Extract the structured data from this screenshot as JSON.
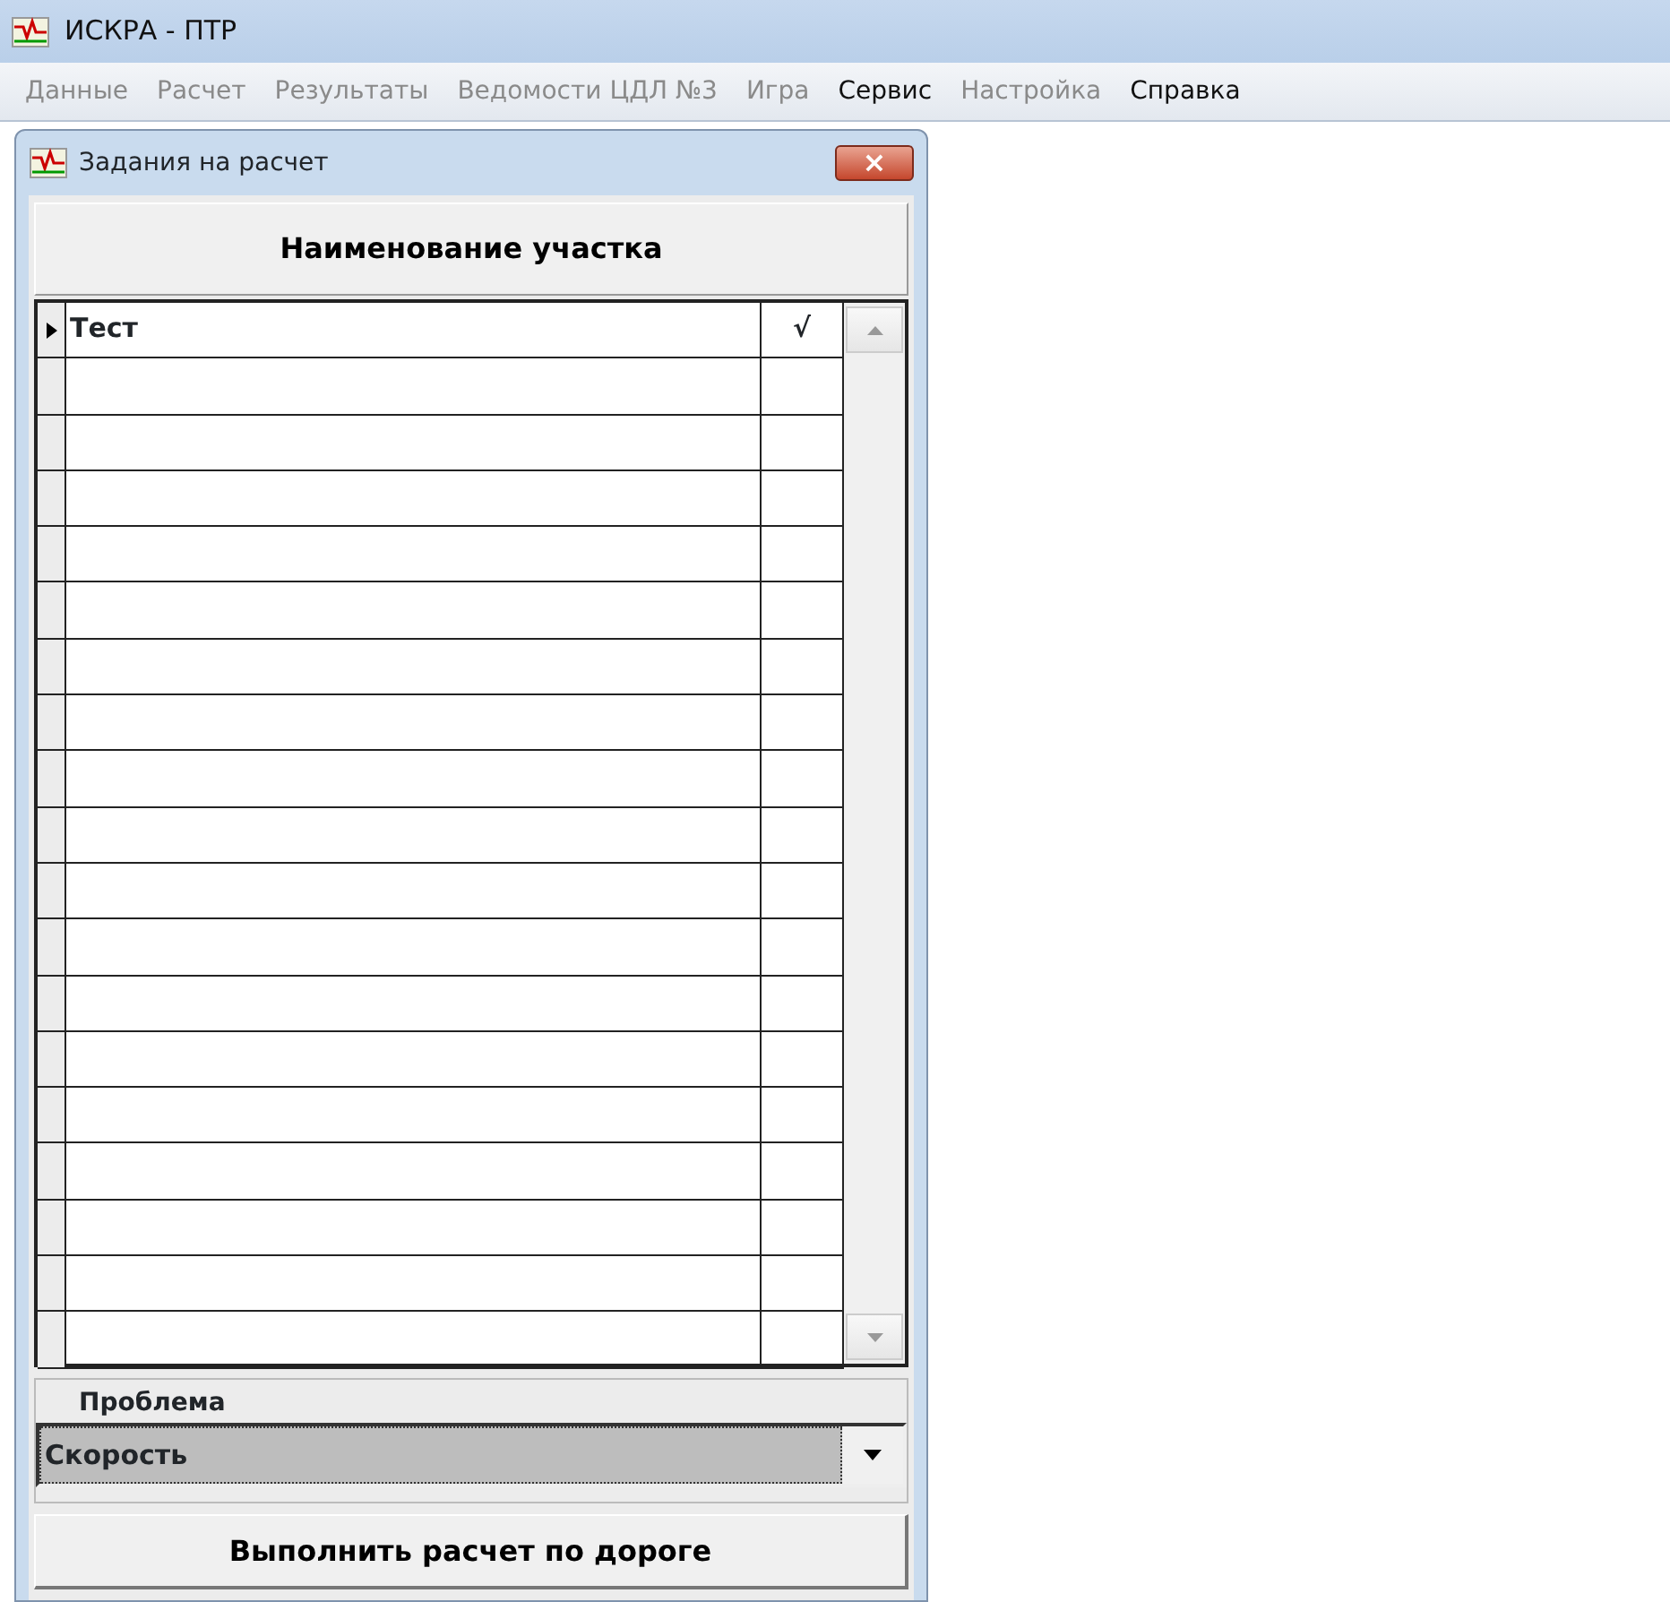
{
  "window": {
    "title": "ИСКРА - ПТР"
  },
  "menu": [
    {
      "label": "Данные",
      "disabled": true
    },
    {
      "label": "Расчет",
      "disabled": true
    },
    {
      "label": "Результаты",
      "disabled": true
    },
    {
      "label": "Ведомости ЦДЛ №3",
      "disabled": true
    },
    {
      "label": "Игра",
      "disabled": true
    },
    {
      "label": "Сервис",
      "disabled": false
    },
    {
      "label": "Настройка",
      "disabled": true
    },
    {
      "label": "Справка",
      "disabled": false
    }
  ],
  "dialog": {
    "title": "Задания на расчет",
    "close": "×",
    "header": "Наименование участка",
    "rows": [
      {
        "name": "Тест",
        "mark": "√",
        "selected": true
      }
    ],
    "problem": {
      "label": "Проблема",
      "value": "Скорость"
    },
    "run_button": "Выполнить расчет по дороге"
  }
}
